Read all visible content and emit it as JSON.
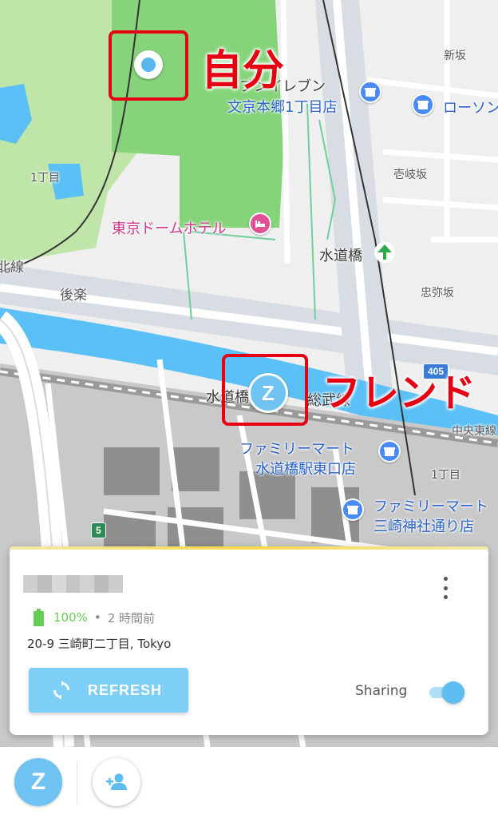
{
  "map": {
    "labels": {
      "seven_eleven_1": "ブンイレブン",
      "seven_eleven_2": "文京本郷1丁目店",
      "lawson": "ローソン",
      "shinzaka": "新坂",
      "ikizaka": "壱岐坂",
      "chome1_left": "1丁目",
      "tokyo_dome_hotel": "東京ドームホテル",
      "suidobashi_park": "水道橋",
      "line_fragment": "北線",
      "korakuen": "後楽",
      "chuyazaka": "忠弥坂",
      "suidobashi_station": "水道橋",
      "sobu_line": "総武線",
      "chuo_line": "中央東線",
      "familymart1_a": "ファミリーマート",
      "familymart1_b": "水道橋駅東口店",
      "chome1_right": "1丁目",
      "familymart2_a": "ファミリーマート",
      "familymart2_b": "三崎神社通り店",
      "route_405": "405",
      "route_5": "5"
    },
    "friend_initial": "Z",
    "colors": {
      "park": "#7fd36b",
      "river": "#5bc0f5",
      "road": "#ffffff",
      "annotation": "#e60012"
    }
  },
  "annotations": {
    "self_label": "自分",
    "friend_label": "フレンド"
  },
  "card": {
    "battery_percent": "100%",
    "separator": "•",
    "last_updated": "2 時間前",
    "address": "20-9 三崎町二丁目, Tokyo",
    "refresh_label": "REFRESH",
    "sharing_label": "Sharing",
    "sharing_on": true,
    "accent_color": "#7ecff5",
    "battery_color": "#66cc55"
  },
  "bottom_bar": {
    "avatar_initial": "Z"
  },
  "icons": {
    "more": "more-vertical-icon",
    "refresh": "refresh-icon",
    "battery": "battery-full-icon",
    "add_friend": "add-person-icon",
    "store": "store-icon",
    "hotel": "hotel-bed-icon",
    "park": "tree-icon"
  }
}
